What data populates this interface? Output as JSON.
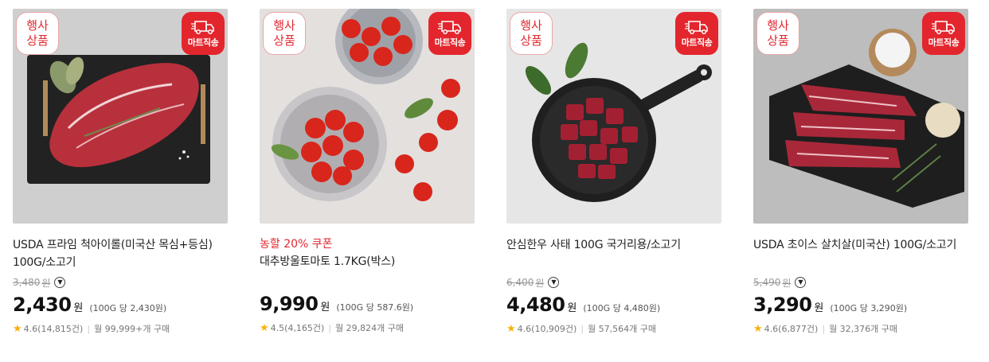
{
  "badges": {
    "event_line1": "행사",
    "event_line2": "상품",
    "mart_label": "마트직송"
  },
  "products": [
    {
      "image": "beef-ribeye-steak",
      "promo": "",
      "title_line1": "USDA 프라임 척아이롤(미국산 목심+등심)",
      "title_line2": "100G/소고기",
      "original_price": "3,480",
      "original_unit": "원",
      "price": "2,430",
      "price_unit": "원",
      "unit_price": "(100G 당 2,430원)",
      "rating": "4.6(14,815건)",
      "purchases": "월 99,999+개 구매"
    },
    {
      "image": "cherry-tomatoes",
      "promo": "농할 20% 쿠폰",
      "title_line1": "대추방울토마토 1.7KG(박스)",
      "title_line2": "",
      "original_price": "",
      "original_unit": "",
      "price": "9,990",
      "price_unit": "원",
      "unit_price": "(100G 당 587.6원)",
      "rating": "4.5(4,165건)",
      "purchases": "월 29,824개 구매"
    },
    {
      "image": "hanwoo-beef-cubes-pan",
      "promo": "",
      "title_line1": "안심한우 사태 100G 국거리용/소고기",
      "title_line2": "",
      "original_price": "6,400",
      "original_unit": "원",
      "price": "4,480",
      "price_unit": "원",
      "unit_price": "(100G 당 4,480원)",
      "rating": "4.6(10,909건)",
      "purchases": "월 57,564개 구매"
    },
    {
      "image": "beef-sirloin-strips",
      "promo": "",
      "title_line1": "USDA 초이스 살치살(미국산) 100G/소고기",
      "title_line2": "",
      "original_price": "5,490",
      "original_unit": "원",
      "price": "3,290",
      "price_unit": "원",
      "unit_price": "(100G 당 3,290원)",
      "rating": "4.6(6,877건)",
      "purchases": "월 32,376개 구매"
    }
  ],
  "icons": {
    "delivery": "truck-icon",
    "toggle": "chevron-down-icon",
    "star": "star-icon"
  },
  "colors": {
    "accent_red": "#e3262d",
    "star": "#f6b20a"
  }
}
